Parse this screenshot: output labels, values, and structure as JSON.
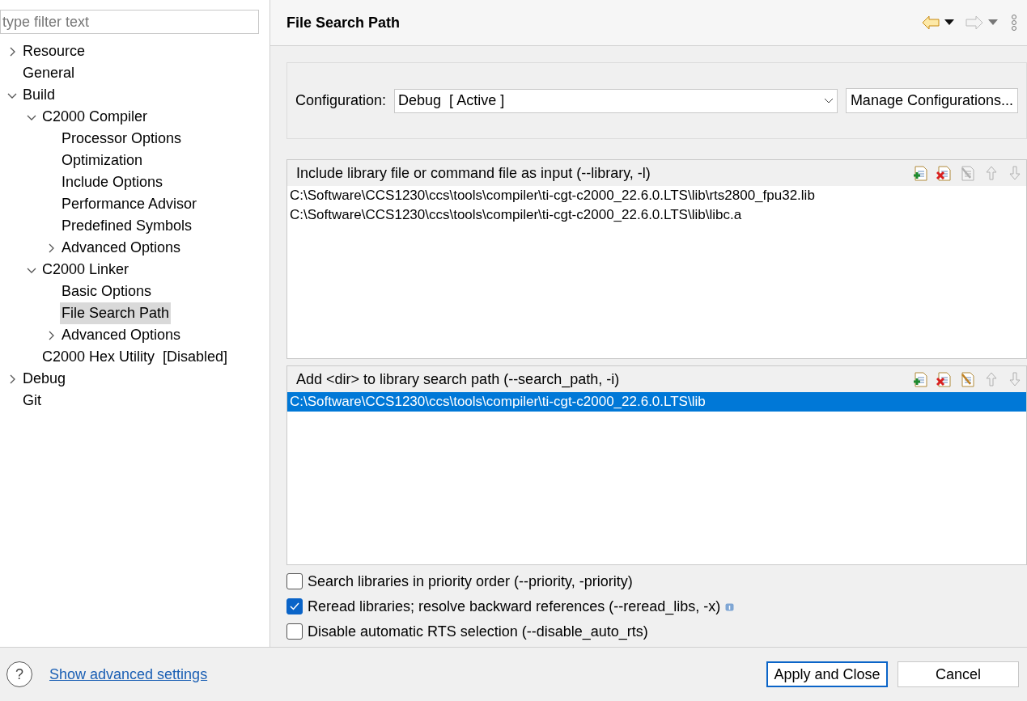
{
  "filter": {
    "placeholder": "type filter text"
  },
  "tree": [
    {
      "label": "Resource",
      "expanded": false,
      "selected": false
    },
    {
      "label": "General",
      "selected": false
    },
    {
      "label": "Build",
      "expanded": true,
      "selected": false,
      "children": [
        {
          "label": "C2000 Compiler",
          "expanded": true,
          "selected": false,
          "children": [
            {
              "label": "Processor Options",
              "selected": false
            },
            {
              "label": "Optimization",
              "selected": false
            },
            {
              "label": "Include Options",
              "selected": false
            },
            {
              "label": "Performance Advisor",
              "selected": false
            },
            {
              "label": "Predefined Symbols",
              "selected": false
            },
            {
              "label": "Advanced Options",
              "expanded": false,
              "selected": false
            }
          ]
        },
        {
          "label": "C2000 Linker",
          "expanded": true,
          "selected": false,
          "children": [
            {
              "label": "Basic Options",
              "selected": false
            },
            {
              "label": "File Search Path",
              "selected": true
            },
            {
              "label": "Advanced Options",
              "expanded": false,
              "selected": false
            }
          ]
        },
        {
          "label": "C2000 Hex Utility  [Disabled]",
          "selected": false
        }
      ]
    },
    {
      "label": "Debug",
      "expanded": false,
      "selected": false
    },
    {
      "label": "Git",
      "selected": false
    }
  ],
  "page": {
    "title": "File Search Path",
    "back_disabled": false,
    "forward_disabled": true
  },
  "configuration": {
    "label": "Configuration:",
    "value": "Debug  [ Active ]",
    "manage_button": "Manage Configurations..."
  },
  "lists": [
    {
      "title": "Include library file or command file as input (--library, -l)",
      "tools": [
        {
          "kind": "add",
          "disabled": false
        },
        {
          "kind": "remove",
          "disabled": false
        },
        {
          "kind": "edit",
          "disabled": true
        },
        {
          "kind": "up",
          "disabled": true
        },
        {
          "kind": "down",
          "disabled": true
        }
      ],
      "items": [
        {
          "text": "C:\\Software\\CCS1230\\ccs\\tools\\compiler\\ti-cgt-c2000_22.6.0.LTS\\lib\\rts2800_fpu32.lib",
          "selected": false
        },
        {
          "text": "C:\\Software\\CCS1230\\ccs\\tools\\compiler\\ti-cgt-c2000_22.6.0.LTS\\lib\\libc.a",
          "selected": false
        }
      ]
    },
    {
      "title": "Add <dir> to library search path (--search_path, -i)",
      "tools": [
        {
          "kind": "add",
          "disabled": false
        },
        {
          "kind": "remove",
          "disabled": false
        },
        {
          "kind": "edit",
          "disabled": false
        },
        {
          "kind": "up",
          "disabled": true
        },
        {
          "kind": "down",
          "disabled": true
        }
      ],
      "items": [
        {
          "text": "C:\\Software\\CCS1230\\ccs\\tools\\compiler\\ti-cgt-c2000_22.6.0.LTS\\lib",
          "selected": true
        }
      ]
    }
  ],
  "options": [
    {
      "label": "Search libraries in priority order (--priority, -priority)",
      "checked": false
    },
    {
      "label": "Reread libraries; resolve backward references (--reread_libs, -x)",
      "checked": true,
      "info": true
    },
    {
      "label": "Disable automatic RTS selection (--disable_auto_rts)",
      "checked": false
    }
  ],
  "footer": {
    "help": "?",
    "link": "Show advanced settings",
    "apply": "Apply and Close",
    "cancel": "Cancel"
  }
}
